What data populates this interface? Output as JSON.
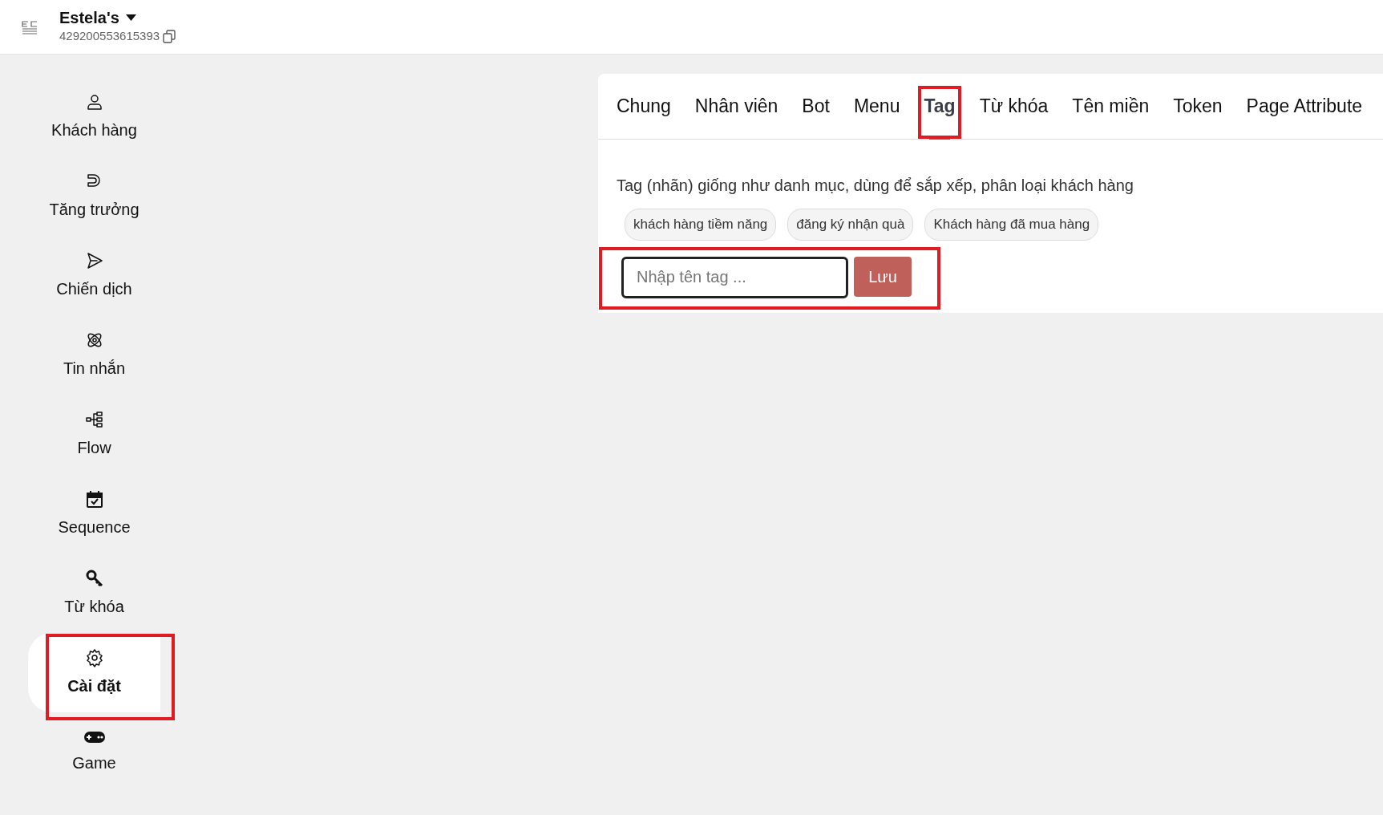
{
  "header": {
    "page_name": "Estela's",
    "page_id": "429200553615393"
  },
  "sidebar": {
    "items": [
      {
        "label": "Khách hàng",
        "selected": false,
        "highlighted": false
      },
      {
        "label": "Tăng trưởng",
        "selected": false,
        "highlighted": false
      },
      {
        "label": "Chiến dịch",
        "selected": false,
        "highlighted": false
      },
      {
        "label": "Tin nhắn",
        "selected": false,
        "highlighted": false
      },
      {
        "label": "Flow",
        "selected": false,
        "highlighted": false
      },
      {
        "label": "Sequence",
        "selected": false,
        "highlighted": false
      },
      {
        "label": "Từ khóa",
        "selected": false,
        "highlighted": false
      },
      {
        "label": "Cài đặt",
        "selected": true,
        "highlighted": true
      },
      {
        "label": "Game",
        "selected": false,
        "highlighted": false
      }
    ]
  },
  "tabs": [
    {
      "label": "Chung",
      "selected": false,
      "highlighted": false
    },
    {
      "label": "Nhân viên",
      "selected": false,
      "highlighted": false
    },
    {
      "label": "Bot",
      "selected": false,
      "highlighted": false
    },
    {
      "label": "Menu",
      "selected": false,
      "highlighted": false
    },
    {
      "label": "Tag",
      "selected": true,
      "highlighted": true
    },
    {
      "label": "Từ khóa",
      "selected": false,
      "highlighted": false
    },
    {
      "label": "Tên miền",
      "selected": false,
      "highlighted": false
    },
    {
      "label": "Token",
      "selected": false,
      "highlighted": false
    },
    {
      "label": "Page Attribute",
      "selected": false,
      "highlighted": false
    }
  ],
  "tag_panel": {
    "description": "Tag (nhãn) giống như danh mục, dùng để sắp xếp, phân loại khách hàng",
    "tags": [
      "khách hàng tiềm năng",
      "đăng ký nhận quà",
      "Khách hàng đã mua hàng"
    ],
    "form": {
      "placeholder": "Nhập tên tag ...",
      "button": "Lưu",
      "highlighted": true
    }
  }
}
